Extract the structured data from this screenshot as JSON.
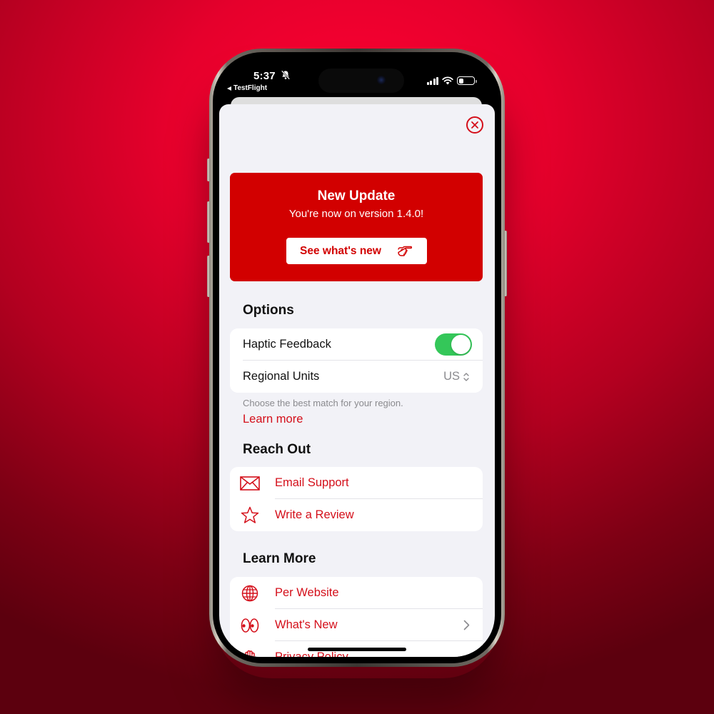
{
  "status_bar": {
    "time": "5:37",
    "back_app": "TestFlight",
    "icons": [
      "bell-slash-icon",
      "cellular-signal-icon",
      "wifi-icon",
      "battery-icon"
    ],
    "battery_level": 0.3
  },
  "sheet": {
    "close_icon": "xmark-circle-icon"
  },
  "banner": {
    "title": "New Update",
    "subtitle": "You're now on version 1.4.0!",
    "button_label": "See what's new",
    "button_icon": "hand-point-right-icon",
    "color": "#d20000"
  },
  "options": {
    "title": "Options",
    "rows": [
      {
        "label": "Haptic Feedback",
        "control": "toggle",
        "value": true
      },
      {
        "label": "Regional Units",
        "control": "picker",
        "value": "US"
      }
    ],
    "footnote": "Choose the best match for your region.",
    "link": "Learn more"
  },
  "reach_out": {
    "title": "Reach Out",
    "rows": [
      {
        "label": "Email Support",
        "icon": "envelope-icon"
      },
      {
        "label": "Write a Review",
        "icon": "star-icon"
      }
    ]
  },
  "learn_more": {
    "title": "Learn More",
    "rows": [
      {
        "label": "Per Website",
        "icon": "globe-icon"
      },
      {
        "label": "What's New",
        "icon": "eyes-icon",
        "chevron": true
      },
      {
        "label": "Privacy Policy",
        "icon": "hand-raised-icon"
      }
    ]
  },
  "colors": {
    "accent": "#d40f1a",
    "toggle_on": "#34c759",
    "background_gradient_top": "#ff0033",
    "background_gradient_bottom": "#5c000e"
  }
}
